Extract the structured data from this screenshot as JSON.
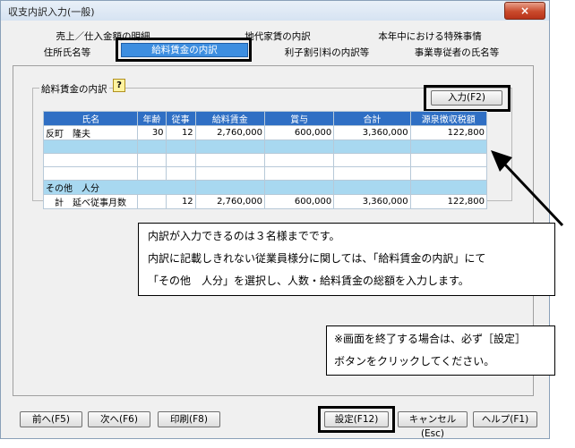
{
  "window": {
    "title": "収支内訳入力(一般)",
    "close_icon": "×"
  },
  "tabs": {
    "row1": [
      "売上／仕入金額の明細",
      "地代家賃の内訳",
      "本年中における特殊事情"
    ],
    "row2": [
      "住所氏名等",
      "給料賃金の内訳",
      "利子割引料の内訳等",
      "事業専従者の氏名等"
    ]
  },
  "group": {
    "label": "給料賃金の内訳",
    "help_icon": "?",
    "input_button": "入力(F2)"
  },
  "table": {
    "headers": [
      "氏名",
      "年齢",
      "従事",
      "給料賃金",
      "賞与",
      "合計",
      "源泉徴収税額"
    ],
    "rows": [
      [
        "反町　隆夫",
        "30",
        "12",
        "2,760,000",
        "600,000",
        "3,360,000",
        "122,800"
      ],
      [
        "",
        "",
        "",
        "",
        "",
        "",
        ""
      ],
      [
        "",
        "",
        "",
        "",
        "",
        "",
        ""
      ],
      [
        "",
        "",
        "",
        "",
        "",
        "",
        ""
      ]
    ],
    "other_label": "その他　人分",
    "total": {
      "label": "計",
      "sublabel": "延べ従事月数",
      "months": "12",
      "salary": "2,760,000",
      "bonus": "600,000",
      "sum": "3,360,000",
      "tax": "122,800"
    }
  },
  "callout1": {
    "line1": "内訳が入力できるのは３名様までです。",
    "line2": "内訳に記載しきれない従業員様分に関しては、「給料賃金の内訳」にて",
    "line3": "「その他　人分」を選択し、人数・給料賃金の総額を入力します。"
  },
  "callout2": {
    "line1": "※画面を終了する場合は、必ず［設定］",
    "line2": "ボタンをクリックしてください。"
  },
  "footer": {
    "prev": "前へ(F5)",
    "next": "次へ(F6)",
    "print": "印刷(F8)",
    "set": "設定(F12)",
    "cancel": "キャンセル(Esc)",
    "help": "ヘルプ(F1)"
  }
}
